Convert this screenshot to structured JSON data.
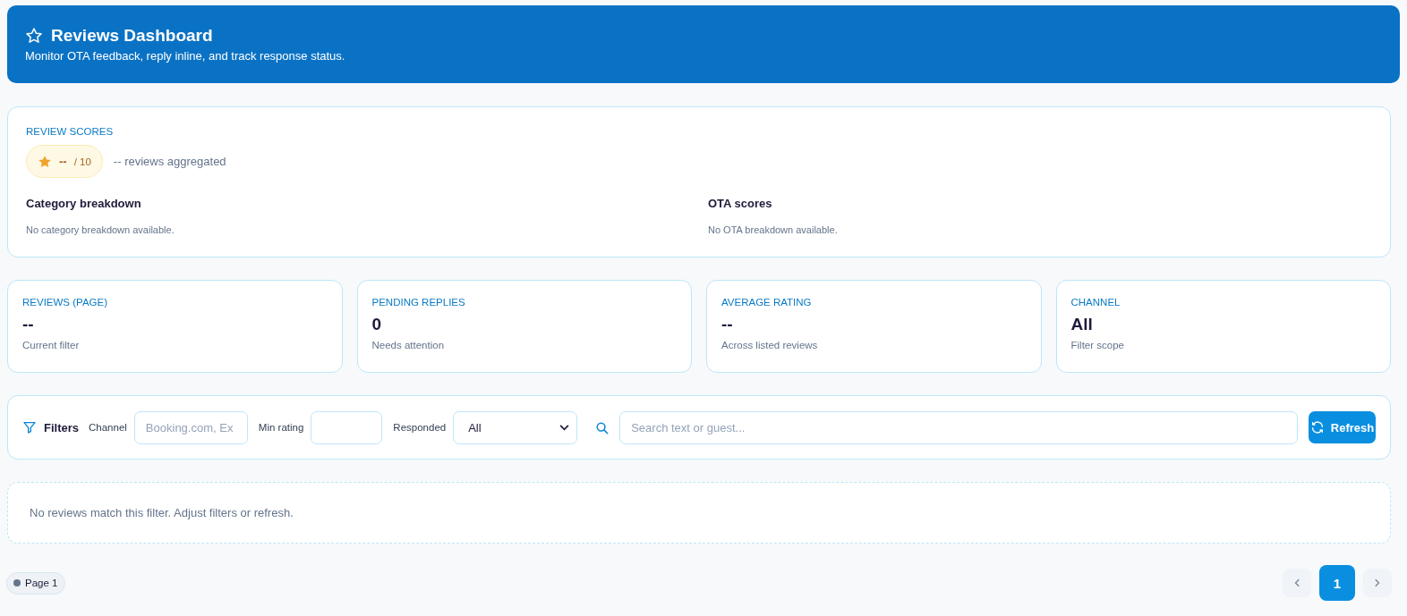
{
  "header": {
    "title": "Reviews Dashboard",
    "subtitle": "Monitor OTA feedback, reply inline, and track response status."
  },
  "scores": {
    "heading": "REVIEW SCORES",
    "score": "--",
    "scale": "/ 10",
    "aggregated": "-- reviews aggregated",
    "sections": [
      {
        "title": "Category breakdown",
        "empty_text": "No category breakdown available."
      },
      {
        "title": "OTA scores",
        "empty_text": "No OTA breakdown available."
      }
    ]
  },
  "stats": [
    {
      "label": "REVIEWS (PAGE)",
      "value": "--",
      "caption": "Current filter"
    },
    {
      "label": "PENDING REPLIES",
      "value": "0",
      "caption": "Needs attention"
    },
    {
      "label": "AVERAGE RATING",
      "value": "--",
      "caption": "Across listed reviews"
    },
    {
      "label": "CHANNEL",
      "value": "All",
      "caption": "Filter scope"
    }
  ],
  "filters": {
    "title": "Filters",
    "channel": {
      "label": "Channel",
      "placeholder": "Booking.com, Ex"
    },
    "min_rating": {
      "label": "Min rating"
    },
    "responded": {
      "label": "Responded",
      "value": "All"
    },
    "search": {
      "placeholder": "Search text or guest..."
    },
    "refresh_button": "Refresh"
  },
  "empty_state": "No reviews match this filter. Adjust filters or refresh.",
  "footer": {
    "page_badge": "Page 1",
    "pagination": {
      "prev": {
        "disabled": true
      },
      "pages": [
        {
          "label": "1",
          "selected": true
        }
      ],
      "next": {
        "disabled": true
      }
    }
  }
}
